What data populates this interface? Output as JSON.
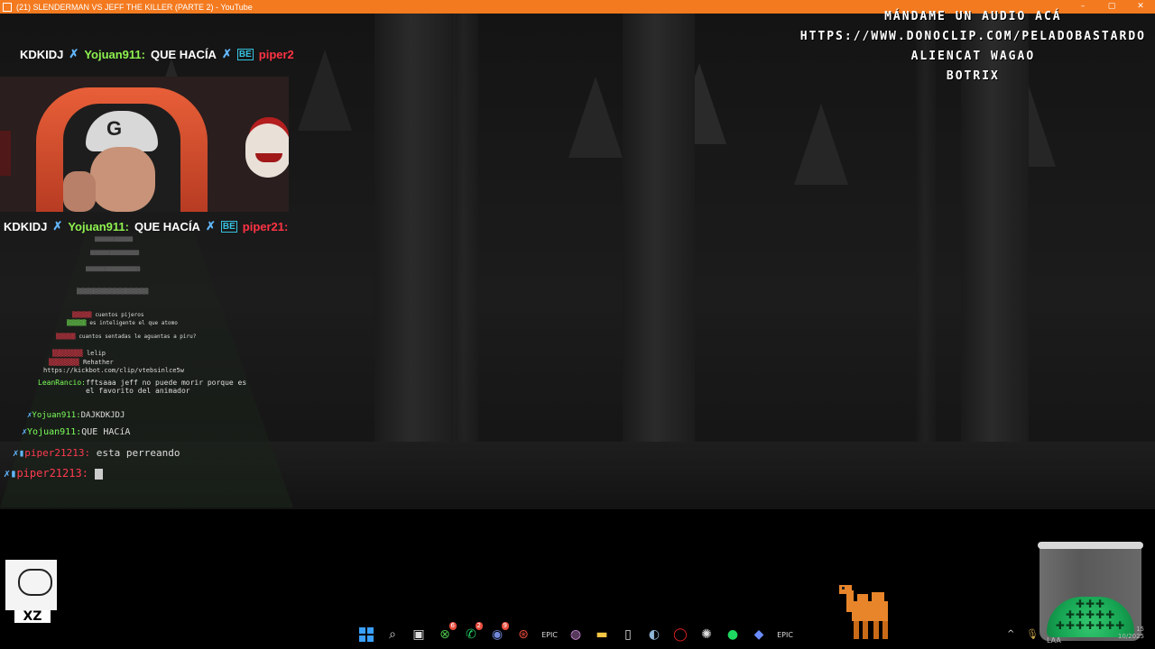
{
  "window": {
    "title": "(21) SLENDERMAN VS JEFF THE KILLER (PARTE 2) - YouTube",
    "minimize": "–",
    "maximize": "▢",
    "close": "✕"
  },
  "donation": {
    "line1": "MÁNDAME UN AUDIO ACÁ",
    "line2": "HTTPS://WWW.DONOCLIP.COM/PELADOBASTARDO",
    "line3": "ALIENCAT WAGAO",
    "line4": "BOTRIX"
  },
  "ticker_top": {
    "user1": "KDKIDJ",
    "sword": "✗",
    "user2": "Yojuan911:",
    "msg": "QUE HACÍA",
    "sword2": "✗",
    "badge": "BE",
    "user3": "piper2"
  },
  "ticker_mid": {
    "user1": "KDKIDJ",
    "sword": "✗",
    "user2": "Yojuan911:",
    "msg": "QUE HACÍA",
    "sword2": "✗",
    "badge": "BE",
    "user3": "piper21:"
  },
  "webcam": {
    "cap_logo": "G"
  },
  "chat": {
    "l1_text": "cuentos pijeros",
    "l2_text": "es inteligente el que atomo",
    "l3_text": "cuantos sentadas le aguantas a piru?",
    "l4_text": "lelip",
    "l5_text": "Rehather",
    "l6_text": "https://kickbot.com/clip/vtebsinlce5w",
    "l7_user": "LeanRancio:",
    "l7_text": "fftsaaa jeff no puede morir porque es el favorito del animador",
    "l8_user": "Yojuan911:",
    "l8_text": "DAJKDKJDJ",
    "l9_user": "Yojuan911:",
    "l9_text": "QUE HACíA",
    "l10_user": "piper21213:",
    "l10_text": "esta perreando",
    "l11_user": "piper21213:"
  },
  "sticker": {
    "text": "XZ"
  },
  "taskbar": {
    "icons": [
      "windows-icon",
      "search-icon",
      "task-view-icon",
      "xbox-icon",
      "whatsapp-icon",
      "discord-icon",
      "app-icon",
      "epic-games-icon",
      "browser-icon",
      "file-explorer-icon",
      "document-icon",
      "steam-icon",
      "opera-icon",
      "chatgpt-icon",
      "spotify-icon",
      "app2-icon",
      "epic2-icon"
    ],
    "xbox_badge": "6",
    "whatsapp_badge": "2",
    "discord_badge": "9"
  },
  "tray": {
    "chevron": "^",
    "lang": "LAA",
    "time": "15",
    "date": "10/2025"
  }
}
